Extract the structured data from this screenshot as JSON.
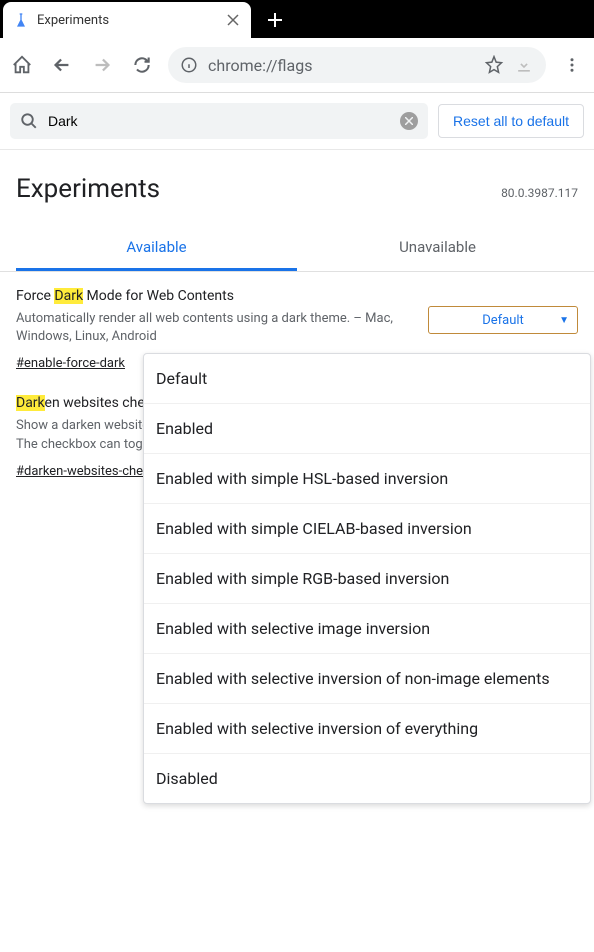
{
  "browser": {
    "tab_title": "Experiments",
    "url": "chrome://flags"
  },
  "search": {
    "value": "Dark",
    "reset_label": "Reset all to default"
  },
  "page": {
    "title": "Experiments",
    "version": "80.0.3987.117"
  },
  "tabs": {
    "available": "Available",
    "unavailable": "Unavailable"
  },
  "flags": [
    {
      "title_before": "Force ",
      "title_highlight": "Dark",
      "title_after": " Mode for Web Contents",
      "description": "Automatically render all web contents using a dark theme. – Mac, Windows, Linux, Android",
      "anchor": "#enable-force-dark",
      "selected": "Default"
    },
    {
      "title_before": "",
      "title_highlight": "Dark",
      "title_after": "en websites check",
      "description": "Show a darken websites checkbox in themes settings when system default or dark is selected. The checkbox can toggle the auto-darkening web contents feature",
      "anchor": "#darken-websites-check"
    }
  ],
  "dropdown": [
    "Default",
    "Enabled",
    "Enabled with simple HSL-based inversion",
    "Enabled with simple CIELAB-based inversion",
    "Enabled with simple RGB-based inversion",
    "Enabled with selective image inversion",
    "Enabled with selective inversion of non-image elements",
    "Enabled with selective inversion of everything",
    "Disabled"
  ]
}
